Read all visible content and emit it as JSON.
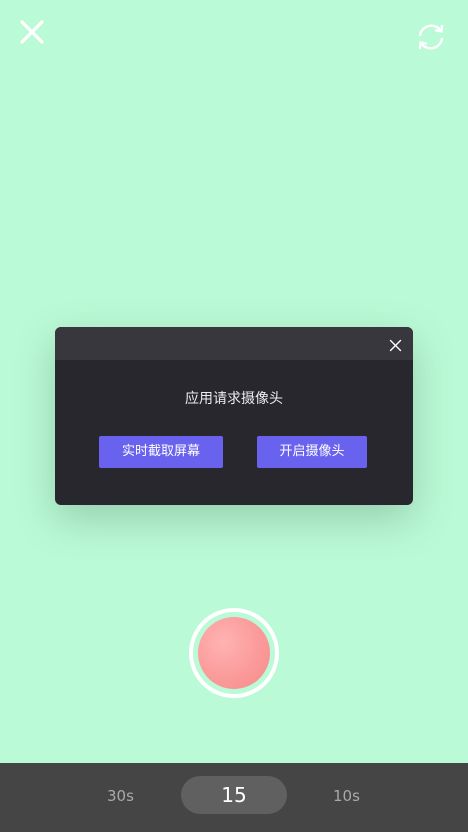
{
  "colors": {
    "background": "#bbfad6",
    "dialog_body": "#28272d",
    "dialog_header": "#38373d",
    "accent_button": "#6962ee",
    "record_button": "#fb9a9a",
    "bottom_bar": "#454545"
  },
  "toolbar": {
    "close_icon": "close-icon",
    "switch_icon": "camera-switch-icon"
  },
  "dialog": {
    "close_icon": "close-icon",
    "message": "应用请求摄像头",
    "screen_capture_label": "实时截取屏幕",
    "open_camera_label": "开启摄像头"
  },
  "durations": {
    "left": "30s",
    "selected": "15",
    "right": "10s"
  }
}
